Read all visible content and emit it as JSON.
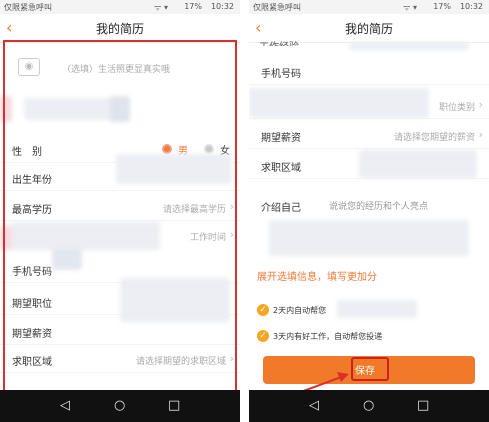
{
  "status": {
    "carrier": "仅限紧急呼叫",
    "signal": "ᯤ ▾",
    "battery": "17%",
    "time": "10:32"
  },
  "left": {
    "title": "我的简历",
    "photo_tip": "（选填）生活照更显真实哦",
    "gender_label": "性　别",
    "gender_male": "男",
    "gender_female": "女",
    "birth_label": "出生年份",
    "edu_label": "最高学历",
    "edu_placeholder": "请选择最高学历",
    "work_time_placeholder": "工作时间",
    "phone_label": "手机号码",
    "job_label": "期望职位",
    "salary_label": "期望薪资",
    "area_label": "求职区域",
    "area_placeholder": "请选择期望的求职区域"
  },
  "right": {
    "title": "我的简历",
    "partial_top": "工作经验",
    "phone_label": "手机号码",
    "job_category_placeholder": "职位类别",
    "salary_label": "期望薪资",
    "salary_placeholder": "请选择您期望的薪资",
    "area_label": "求职区域",
    "intro_label": "介绍自己",
    "intro_placeholder": "说说您的经历和个人亮点",
    "expand_text": "展开选填信息，填写更加分",
    "check1": "2天内自动帮您",
    "check2": "3天内有好工作，自动帮您投递",
    "save_label": "保存"
  },
  "nav": {
    "back": "◁",
    "home": "○",
    "recent": "□"
  },
  "colors": {
    "accent": "#f07a35",
    "highlight": "#d9302a"
  }
}
